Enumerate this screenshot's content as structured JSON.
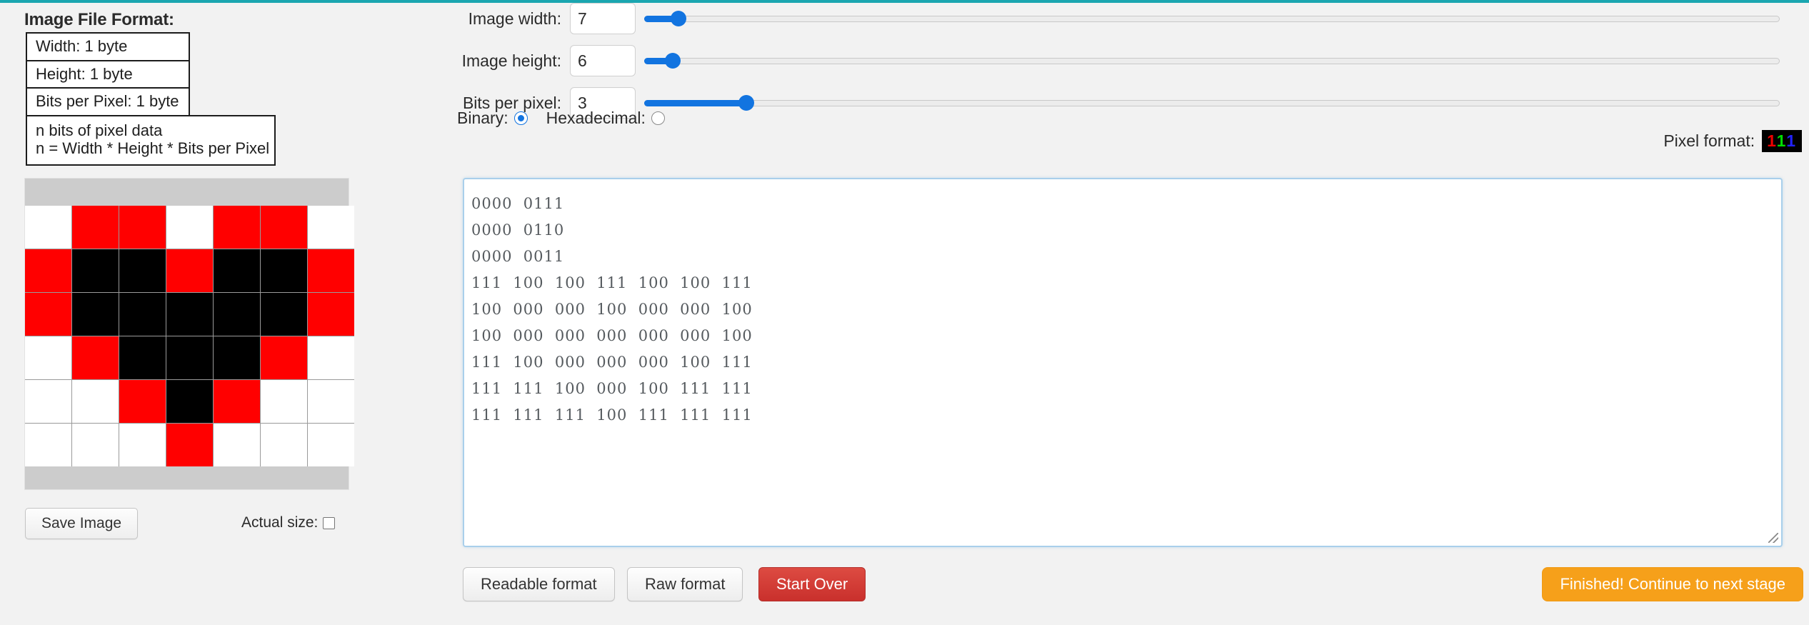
{
  "theme": {
    "top_rule_color": "#1aa6b0",
    "page_bg": "#f2f2f2",
    "slider_accent": "#1274e0",
    "danger_color": "#c9302c",
    "primary_cta_color": "#f6a01a",
    "pixel_on_color": "#ff0000",
    "pixel_black_color": "#000000",
    "pixel_off_color": "#ffffff"
  },
  "left_panel": {
    "title": "Image File Format:",
    "format_rows": [
      "Width: 1 byte",
      "Height: 1 byte",
      "Bits per Pixel: 1 byte"
    ],
    "format_note_line1": "n bits of pixel data",
    "format_note_line2": "n = Width * Height * Bits per Pixel",
    "save_image_label": "Save Image",
    "actual_size_label": "Actual size:",
    "actual_size_checked": false
  },
  "controls": {
    "width_label": "Image width:",
    "width_value": "7",
    "width_slider_percent": 3,
    "height_label": "Image height:",
    "height_value": "6",
    "height_slider_percent": 2.5,
    "bits_label": "Bits per pixel:",
    "bits_value": "3",
    "bits_slider_percent": 9,
    "binary_label": "Binary:",
    "binary_selected": true,
    "hexadecimal_label": "Hexadecimal:",
    "hexadecimal_selected": false,
    "pixel_format_label": "Pixel format:",
    "pixel_format_bits": [
      "1",
      "1",
      "1"
    ]
  },
  "data_area": {
    "lines": [
      "0000  0111",
      "0000  0110",
      "0000  0011",
      "111  100  100  111  100  100  111",
      "100  000  000  100  000  000  100",
      "100  000  000  000  000  000  100",
      "111  100  000  000  000  100  111",
      "111  111  100  000  100  111  111",
      "111  111  111  100  111  111  111"
    ],
    "text": "0000  0111\n0000  0110\n0000  0011\n111  100  100  111  100  100  111\n100  000  000  100  000  000  100\n100  000  000  000  000  000  100\n111  100  000  000  000  100  111\n111  111  100  000  100  111  111\n111  111  111  100  111  111  111"
  },
  "image_preview": {
    "width": 7,
    "height": 6,
    "bits_per_pixel": 3,
    "pixel_rows": [
      [
        "#ffffff",
        "#ff0000",
        "#ff0000",
        "#ffffff",
        "#ff0000",
        "#ff0000",
        "#ffffff"
      ],
      [
        "#ff0000",
        "#000000",
        "#000000",
        "#ff0000",
        "#000000",
        "#000000",
        "#ff0000"
      ],
      [
        "#ff0000",
        "#000000",
        "#000000",
        "#000000",
        "#000000",
        "#000000",
        "#ff0000"
      ],
      [
        "#ffffff",
        "#ff0000",
        "#000000",
        "#000000",
        "#000000",
        "#ff0000",
        "#ffffff"
      ],
      [
        "#ffffff",
        "#ffffff",
        "#ff0000",
        "#000000",
        "#ff0000",
        "#ffffff",
        "#ffffff"
      ],
      [
        "#ffffff",
        "#ffffff",
        "#ffffff",
        "#ff0000",
        "#ffffff",
        "#ffffff",
        "#ffffff"
      ]
    ]
  },
  "footer_buttons": {
    "readable": "Readable format",
    "raw": "Raw format",
    "start_over": "Start Over",
    "finished": "Finished! Continue to next stage"
  }
}
